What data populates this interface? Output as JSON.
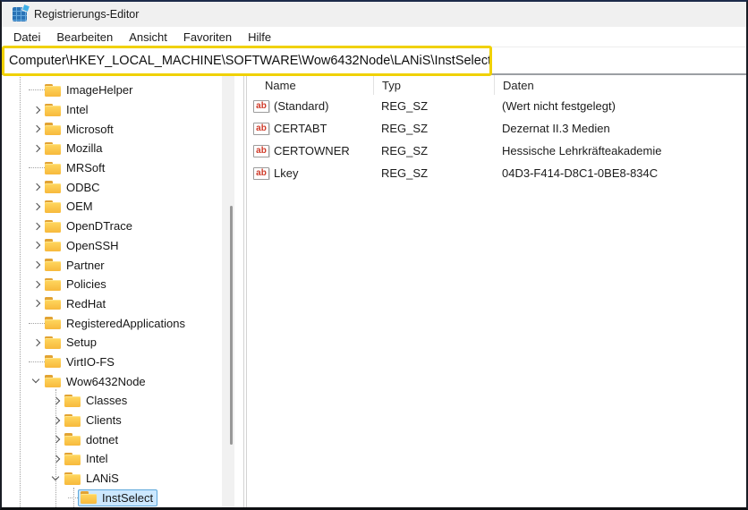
{
  "window": {
    "title": "Registrierungs-Editor",
    "icon": "registry-icon"
  },
  "menu_bar": {
    "items": [
      "Datei",
      "Bearbeiten",
      "Ansicht",
      "Favoriten",
      "Hilfe"
    ]
  },
  "address_bar": {
    "path": "Computer\\HKEY_LOCAL_MACHINE\\SOFTWARE\\Wow6432Node\\LANiS\\InstSelect",
    "annotation": "yellow-highlight-box",
    "annotation_color": "#f0d103"
  },
  "tree_pane": {
    "items": [
      {
        "label": "ImageHelper",
        "level": 0,
        "state": "leaf"
      },
      {
        "label": "Intel",
        "level": 0,
        "state": "collapsed"
      },
      {
        "label": "Microsoft",
        "level": 0,
        "state": "collapsed"
      },
      {
        "label": "Mozilla",
        "level": 0,
        "state": "collapsed"
      },
      {
        "label": "MRSoft",
        "level": 0,
        "state": "leaf"
      },
      {
        "label": "ODBC",
        "level": 0,
        "state": "collapsed"
      },
      {
        "label": "OEM",
        "level": 0,
        "state": "collapsed"
      },
      {
        "label": "OpenDTrace",
        "level": 0,
        "state": "collapsed"
      },
      {
        "label": "OpenSSH",
        "level": 0,
        "state": "collapsed"
      },
      {
        "label": "Partner",
        "level": 0,
        "state": "collapsed"
      },
      {
        "label": "Policies",
        "level": 0,
        "state": "collapsed"
      },
      {
        "label": "RedHat",
        "level": 0,
        "state": "collapsed"
      },
      {
        "label": "RegisteredApplications",
        "level": 0,
        "state": "leaf"
      },
      {
        "label": "Setup",
        "level": 0,
        "state": "collapsed"
      },
      {
        "label": "VirtIO-FS",
        "level": 0,
        "state": "leaf"
      },
      {
        "label": "Wow6432Node",
        "level": 0,
        "state": "expanded"
      },
      {
        "label": "Classes",
        "level": 1,
        "state": "collapsed"
      },
      {
        "label": "Clients",
        "level": 1,
        "state": "collapsed"
      },
      {
        "label": "dotnet",
        "level": 1,
        "state": "collapsed"
      },
      {
        "label": "Intel",
        "level": 1,
        "state": "collapsed"
      },
      {
        "label": "LANiS",
        "level": 1,
        "state": "expanded"
      },
      {
        "label": "InstSelect",
        "level": 2,
        "state": "leaf",
        "selected": true
      }
    ]
  },
  "list_pane": {
    "columns": [
      "Name",
      "Typ",
      "Daten"
    ],
    "rows": [
      {
        "icon": "string-value-icon",
        "name": "(Standard)",
        "type": "REG_SZ",
        "data": "(Wert nicht festgelegt)"
      },
      {
        "icon": "string-value-icon",
        "name": "CERTABT",
        "type": "REG_SZ",
        "data": "Dezernat II.3 Medien"
      },
      {
        "icon": "string-value-icon",
        "name": "CERTOWNER",
        "type": "REG_SZ",
        "data": "Hessische Lehrkräfteakademie"
      },
      {
        "icon": "string-value-icon",
        "name": "Lkey",
        "type": "REG_SZ",
        "data": "04D3-F414-D8C1-0BE8-834C"
      }
    ]
  },
  "icons": {
    "string_value_glyph": "ab"
  },
  "colors": {
    "selection_bg": "#cce8ff",
    "selection_border": "#5ea7db",
    "folder": "#f7b93c",
    "highlight_yellow": "#f0d103",
    "titlebar_bg": "#f0f0f0",
    "window_top_border": "#1c2b4a"
  }
}
